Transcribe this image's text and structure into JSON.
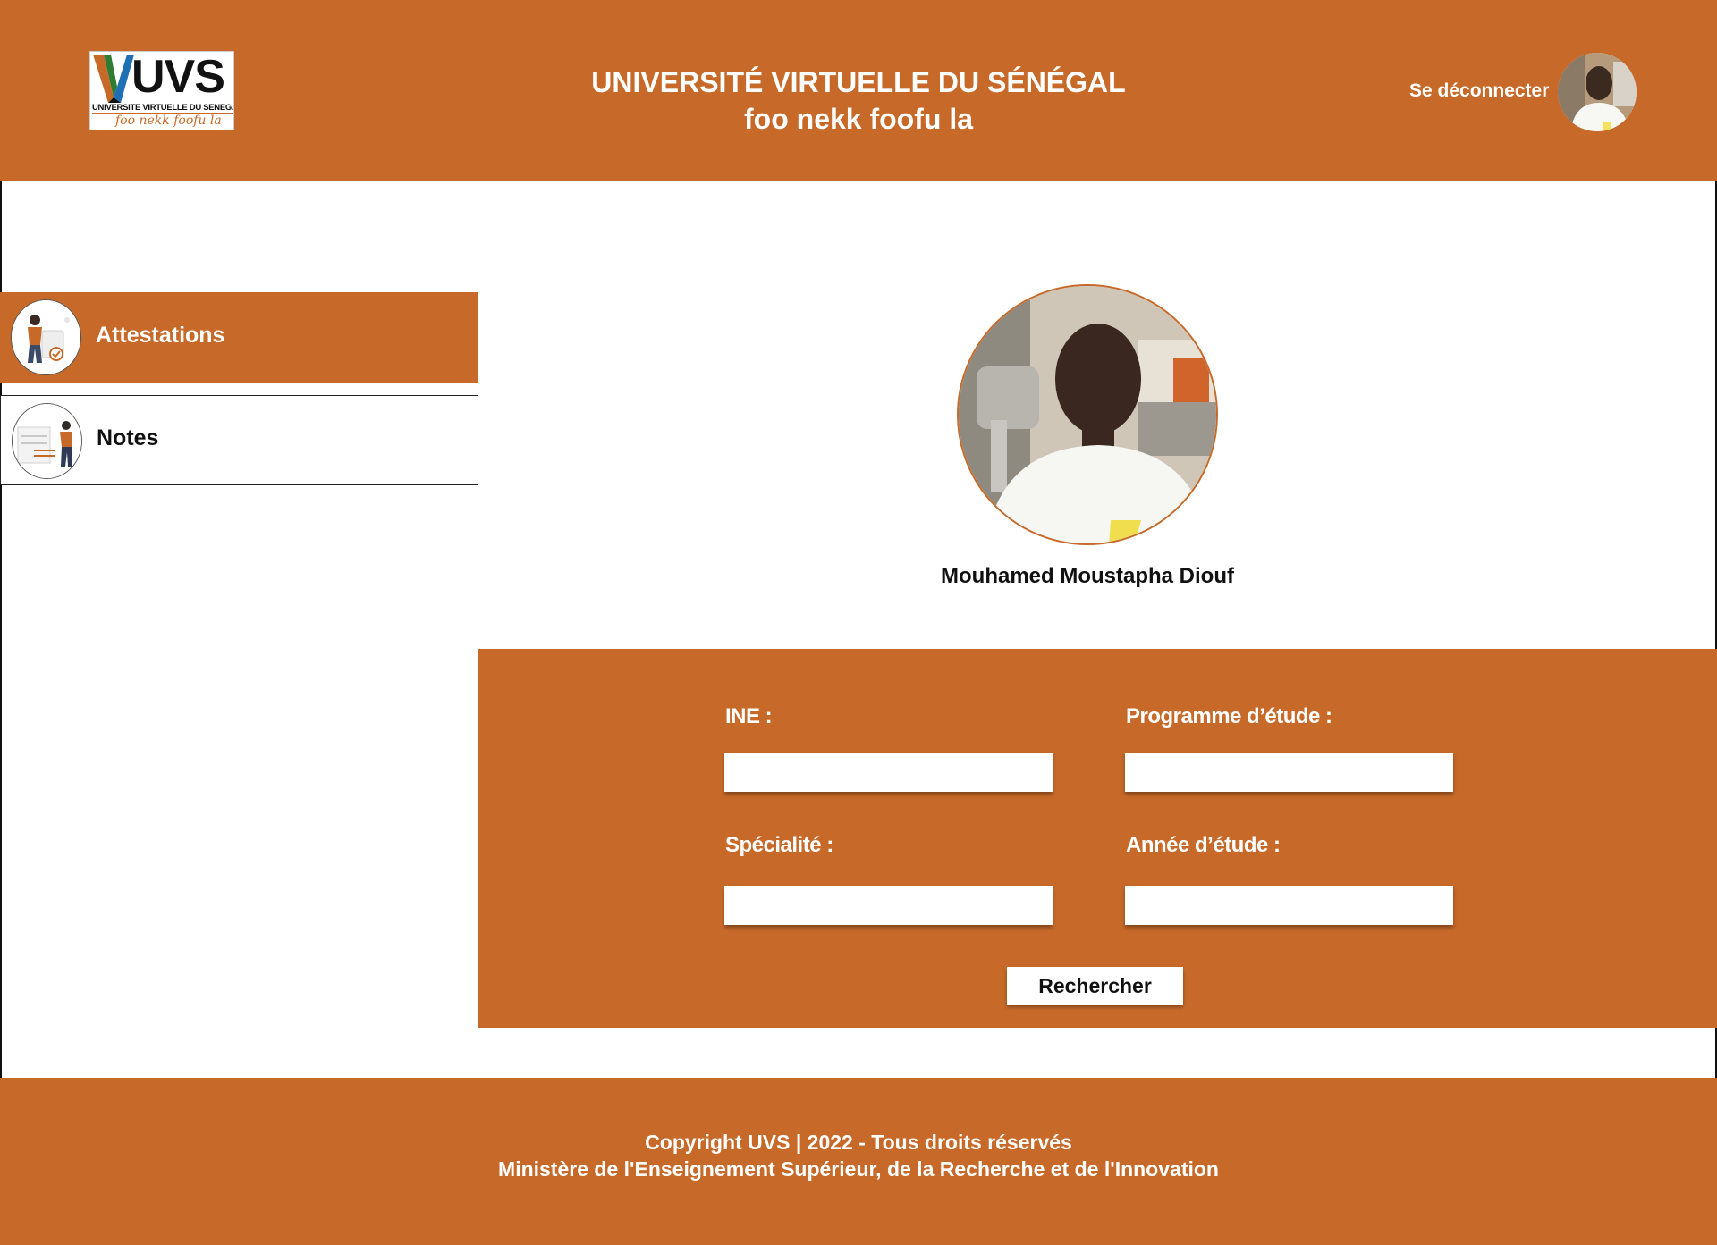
{
  "header": {
    "logo": {
      "brand": "UVS",
      "name": "UNIVERSITE VIRTUELLE DU SENEGAL",
      "tagline": "foo nekk foofu la"
    },
    "title": "UNIVERSITÉ VIRTUELLE DU SÉNÉGAL",
    "subtitle": "foo nekk foofu la",
    "logout_label": "Se déconnecter"
  },
  "sidebar": {
    "items": [
      {
        "label": "Attestations",
        "active": true
      },
      {
        "label": "Notes",
        "active": false
      }
    ]
  },
  "profile": {
    "name": "Mouhamed Moustapha Diouf"
  },
  "form": {
    "ine_label": "INE :",
    "ine_value": "",
    "programme_label": "Programme d’étude :",
    "programme_value": "",
    "specialite_label": "Spécialité :",
    "specialite_value": "",
    "annee_label": "Année d’étude :",
    "annee_value": "",
    "search_label": "Rechercher"
  },
  "footer": {
    "line1": "Copyright UVS | 2022 - Tous droits réservés",
    "line2": "Ministère de l'Enseignement Supérieur, de la Recherche et de l'Innovation"
  },
  "colors": {
    "accent": "#c76a29",
    "background": "#ffffff",
    "text": "#111111"
  }
}
